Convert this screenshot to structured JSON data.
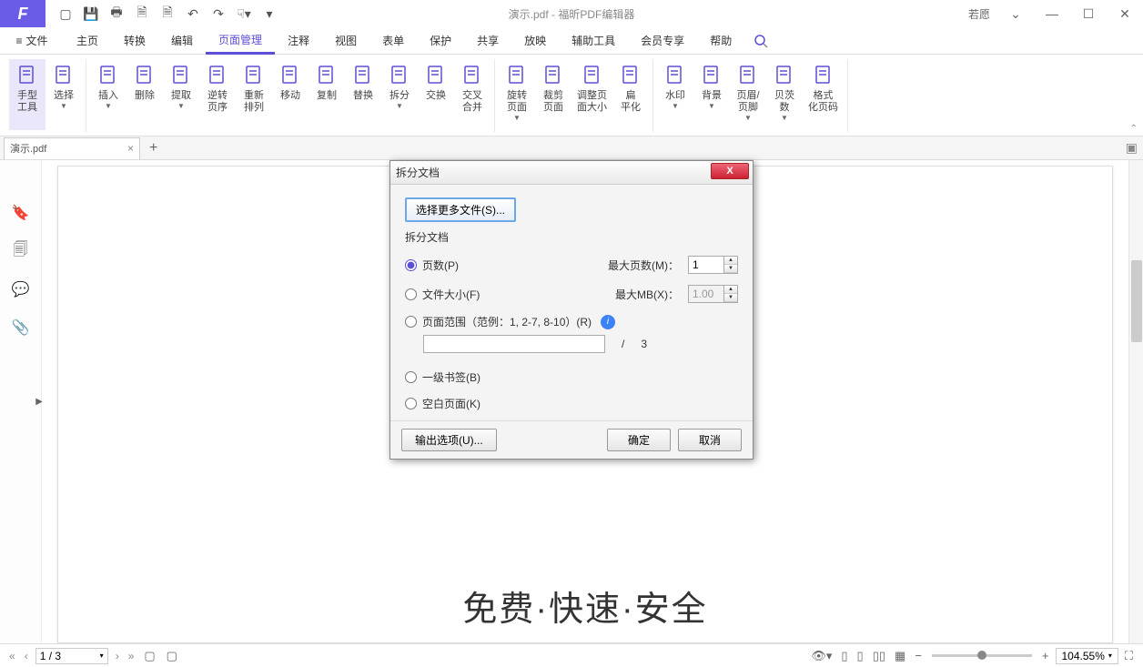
{
  "title": "演示.pdf - 福昕PDF编辑器",
  "user": "若愿",
  "file_menu": "文件",
  "menu": [
    "主页",
    "转换",
    "编辑",
    "页面管理",
    "注释",
    "视图",
    "表单",
    "保护",
    "共享",
    "放映",
    "辅助工具",
    "会员专享",
    "帮助"
  ],
  "active_menu": 3,
  "ribbon": {
    "g1": [
      {
        "l": "手型\n工具"
      },
      {
        "l": "选择",
        "dd": true
      }
    ],
    "g2": [
      {
        "l": "插入",
        "dd": true
      },
      {
        "l": "删除"
      },
      {
        "l": "提取",
        "dd": true
      },
      {
        "l": "逆转\n页序"
      },
      {
        "l": "重新\n排列"
      },
      {
        "l": "移动"
      },
      {
        "l": "复制"
      },
      {
        "l": "替换"
      },
      {
        "l": "拆分",
        "dd": true
      },
      {
        "l": "交换"
      },
      {
        "l": "交叉\n合并"
      }
    ],
    "g3": [
      {
        "l": "旋转\n页面",
        "dd": true
      },
      {
        "l": "裁剪\n页面"
      },
      {
        "l": "调整页\n面大小"
      },
      {
        "l": "扁\n平化"
      }
    ],
    "g4": [
      {
        "l": "水印",
        "dd": true
      },
      {
        "l": "背景",
        "dd": true
      },
      {
        "l": "页眉/\n页脚",
        "dd": true
      },
      {
        "l": "贝茨\n数",
        "dd": true
      },
      {
        "l": "格式\n化页码"
      }
    ]
  },
  "doc_tab": "演示.pdf",
  "hero": "免费·快速·安全",
  "dialog": {
    "title": "拆分文档",
    "select_more": "选择更多文件(S)...",
    "section": "拆分文档",
    "opt_pages": "页数(P)",
    "max_pages": "最大页数(M)：",
    "max_pages_val": "1",
    "opt_size": "文件大小(F)",
    "max_mb": "最大MB(X)：",
    "max_mb_val": "1.00",
    "opt_range": "页面范围（范例：1, 2-7, 8-10）(R)",
    "range_sep": "/",
    "range_total": "3",
    "opt_bookmark": "一级书签(B)",
    "opt_blank": "空白页面(K)",
    "output": "输出选项(U)...",
    "ok": "确定",
    "cancel": "取消"
  },
  "status": {
    "page": "1 / 3",
    "zoom": "104.55%"
  }
}
